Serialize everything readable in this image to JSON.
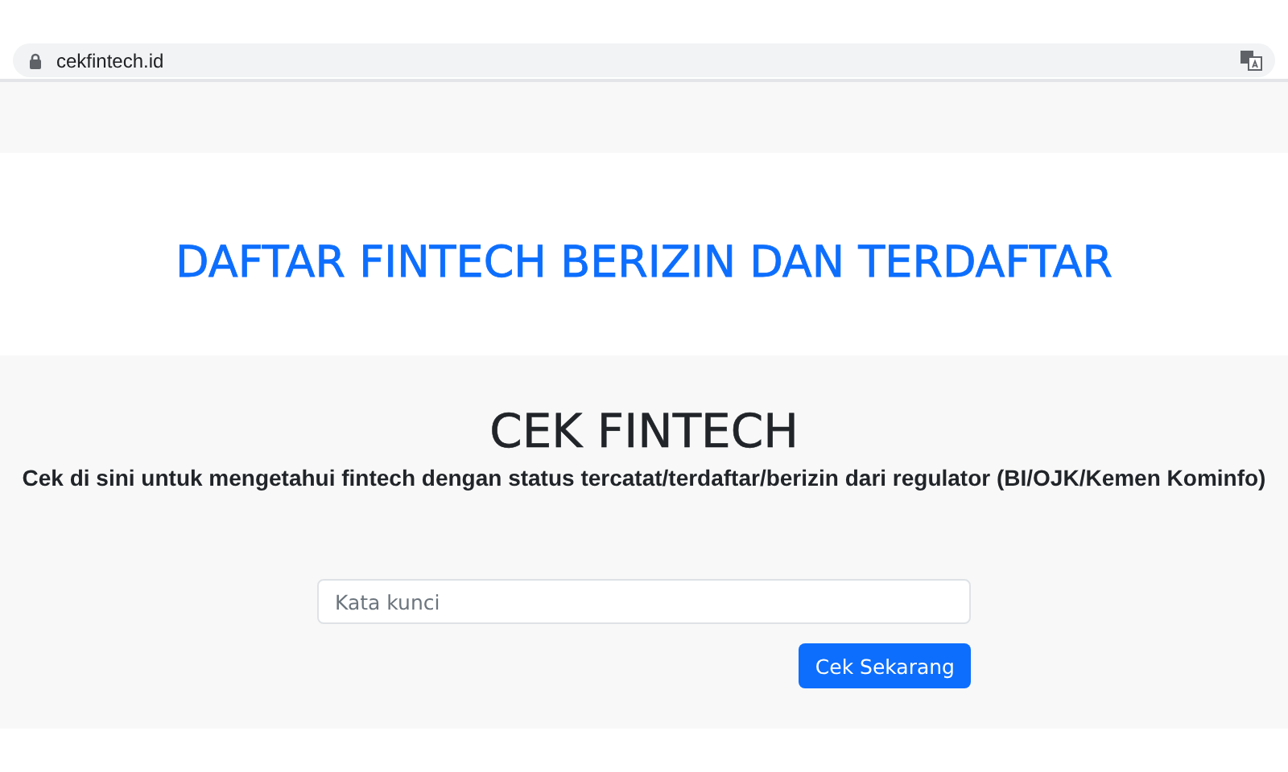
{
  "browser": {
    "url": "cekfintech.id"
  },
  "header": {
    "title": "DAFTAR FINTECH BERIZIN DAN TERDAFTAR"
  },
  "search_section": {
    "title": "CEK FINTECH",
    "subtitle": "Cek di sini untuk mengetahui fintech dengan status tercatat/terdaftar/berizin dari regulator (BI/OJK/Kemen Kominfo)",
    "search": {
      "placeholder": "Kata kunci"
    },
    "button": "Cek Sekarang"
  }
}
